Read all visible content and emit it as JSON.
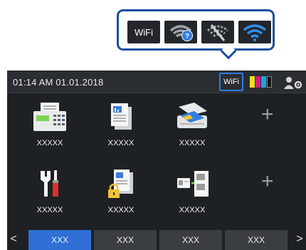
{
  "legend": {
    "wifi_label": "WiFi",
    "icons": [
      "wifi-label-icon",
      "wifi-unknown-icon",
      "wifi-disabled-icon",
      "wifi-connected-icon"
    ]
  },
  "status_bar": {
    "datetime": "01:14 AM  01.01.2018",
    "wifi_label": "WiFi",
    "ink_colors": [
      "#f0e11a",
      "#d8178a",
      "#15a6e0",
      "#111111"
    ]
  },
  "tiles": [
    {
      "label": "XXXXX",
      "icon": "fax-icon"
    },
    {
      "label": "XXXXX",
      "icon": "document-icon"
    },
    {
      "label": "XXXXX",
      "icon": "scanner-icon"
    },
    {
      "label": "XXXXX",
      "icon": "tools-icon"
    },
    {
      "label": "XXXXX",
      "icon": "secure-print-icon"
    },
    {
      "label": "XXXXX",
      "icon": "card-copy-icon"
    }
  ],
  "add_symbol": "+",
  "tabs": [
    {
      "label": "XXX",
      "active": true
    },
    {
      "label": "XXX",
      "active": false
    },
    {
      "label": "XXX",
      "active": false
    },
    {
      "label": "XXX",
      "active": false
    }
  ],
  "nav": {
    "prev": "<",
    "next": ">"
  },
  "colors": {
    "accent": "#2f6fd6",
    "callout_border": "#1a4e9e",
    "screen_bg": "#1e2124"
  }
}
